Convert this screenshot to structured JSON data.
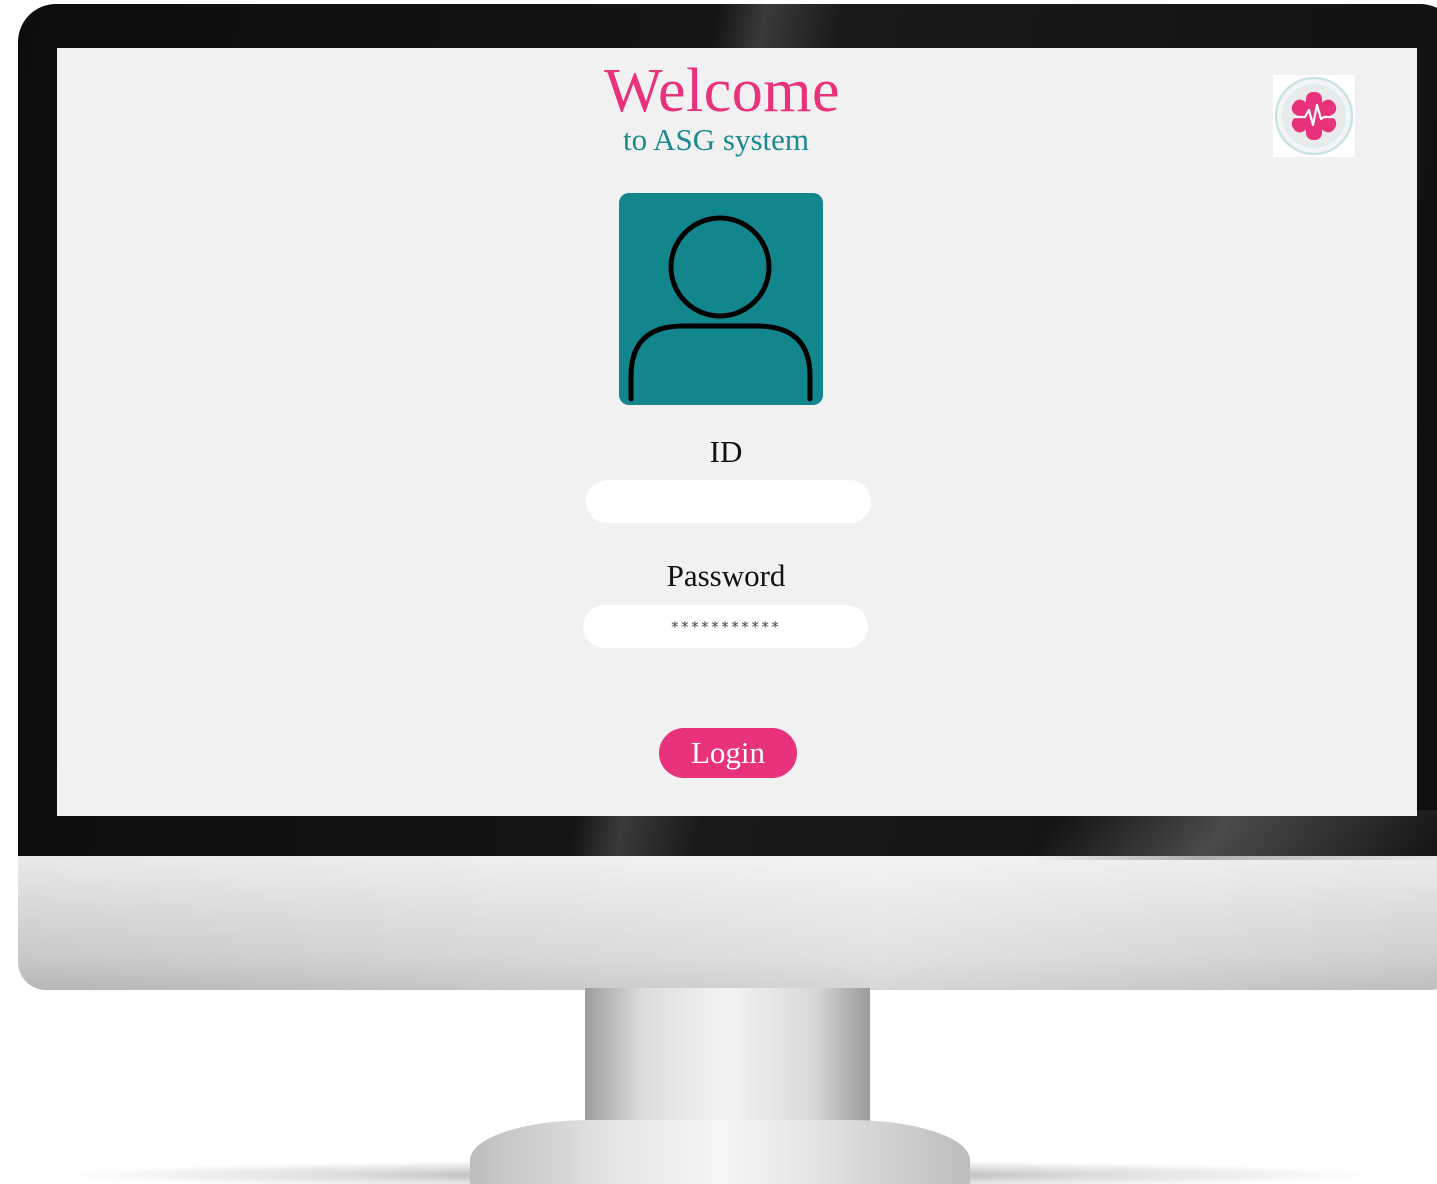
{
  "login_screen": {
    "title": "Welcome",
    "subtitle": "to ASG system",
    "logo_icon": "medical-star-heartbeat-icon",
    "avatar_icon": "user-avatar-icon",
    "id_label": "ID",
    "id_value": "",
    "password_label": "Password",
    "password_value": "***********",
    "login_label": "Login"
  },
  "colors": {
    "accent_pink": "#e8327b",
    "accent_teal": "#12858d",
    "screen_background": "#f1f1f1"
  }
}
